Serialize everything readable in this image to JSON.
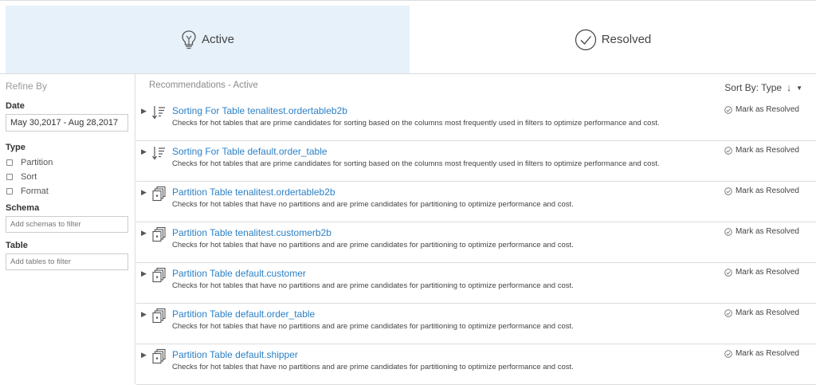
{
  "tabs": {
    "active": {
      "label": "Active",
      "icon": "lightbulb-icon"
    },
    "resolved": {
      "label": "Resolved",
      "icon": "check-circle-icon"
    }
  },
  "sidebar": {
    "title": "Refine By",
    "date_label": "Date",
    "date_value": "May 30,2017 - Aug 28,2017",
    "type_label": "Type",
    "types": [
      "Partition",
      "Sort",
      "Format"
    ],
    "schema_label": "Schema",
    "schema_placeholder": "Add schemas to filter",
    "table_label": "Table",
    "table_placeholder": "Add tables to filter"
  },
  "main": {
    "title": "Recommendations - Active",
    "sort_label": "Sort By: Type",
    "sort_arrow": "↓",
    "sort_caret": "▼",
    "mark_label": "Mark as Resolved",
    "items": [
      {
        "kind": "sort",
        "title": "Sorting For Table tenalitest.ordertableb2b",
        "desc": "Checks for hot tables that are prime candidates for sorting based on the columns most frequently used in filters to optimize performance and cost."
      },
      {
        "kind": "sort",
        "title": "Sorting For Table default.order_table",
        "desc": "Checks for hot tables that are prime candidates for sorting based on the columns most frequently used in filters to optimize performance and cost."
      },
      {
        "kind": "partition",
        "title": "Partition Table tenalitest.ordertableb2b",
        "desc": "Checks for hot tables that have no partitions and are prime candidates for partitioning to optimize performance and cost."
      },
      {
        "kind": "partition",
        "title": "Partition Table tenalitest.customerb2b",
        "desc": "Checks for hot tables that have no partitions and are prime candidates for partitioning to optimize performance and cost."
      },
      {
        "kind": "partition",
        "title": "Partition Table default.customer",
        "desc": "Checks for hot tables that have no partitions and are prime candidates for partitioning to optimize performance and cost."
      },
      {
        "kind": "partition",
        "title": "Partition Table default.order_table",
        "desc": "Checks for hot tables that have no partitions and are prime candidates for partitioning to optimize performance and cost."
      },
      {
        "kind": "partition",
        "title": "Partition Table default.shipper",
        "desc": "Checks for hot tables that have no partitions and are prime candidates for partitioning to optimize performance and cost."
      }
    ]
  },
  "colors": {
    "active_tab_bg": "#e6f1fa",
    "link": "#2b80c6",
    "border": "#dcdcdc"
  }
}
